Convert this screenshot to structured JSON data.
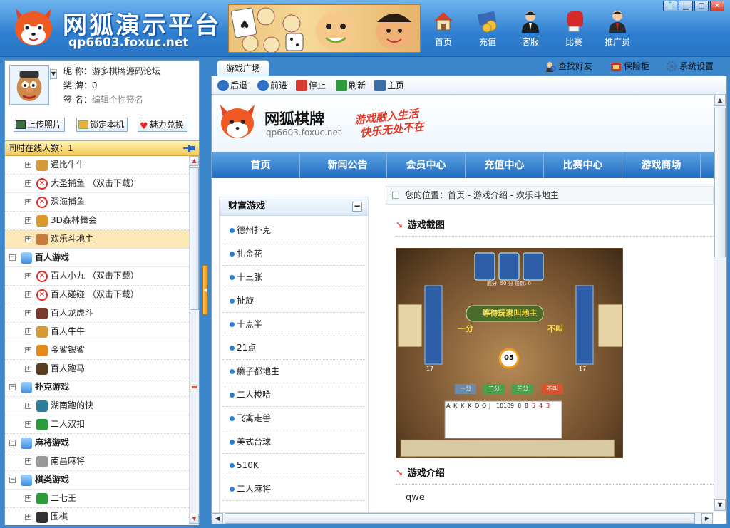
{
  "app": {
    "title": "网狐演示平台",
    "url": "qp6603.foxuc.net"
  },
  "top_nav": [
    {
      "label": "首页",
      "icon": "home-icon"
    },
    {
      "label": "充值",
      "icon": "card-icon"
    },
    {
      "label": "客服",
      "icon": "service-agent-icon"
    },
    {
      "label": "比赛",
      "icon": "boxing-glove-icon"
    },
    {
      "label": "推广员",
      "icon": "promoter-icon"
    }
  ],
  "profile": {
    "nickname_label": "昵  称：",
    "nickname": "游多棋牌源码论坛",
    "medal_label": "奖  牌：",
    "medal": "0",
    "sign_label": "签  名：",
    "sign_placeholder": "编辑个性签名",
    "buttons": [
      "上传照片",
      "锁定本机",
      "魅力兑换"
    ]
  },
  "online": {
    "label": "同时在线人数：",
    "count": "1"
  },
  "tree": [
    {
      "label": "通比牛牛",
      "type": "game",
      "icon": "cow-icon"
    },
    {
      "label": "大圣捕鱼 （双击下载）",
      "type": "game",
      "icon": "download-required-icon"
    },
    {
      "label": "深海捕鱼",
      "type": "game",
      "icon": "download-required-icon"
    },
    {
      "label": "3D森林舞会",
      "type": "game",
      "icon": "lion-icon"
    },
    {
      "label": "欢乐斗地主",
      "type": "game",
      "icon": "farmer-icon",
      "selected": true
    },
    {
      "label": "百人游戏",
      "type": "group"
    },
    {
      "label": "百人小九 （双击下载）",
      "type": "game",
      "icon": "download-required-icon"
    },
    {
      "label": "百人碰碰 （双击下载）",
      "type": "game",
      "icon": "download-required-icon"
    },
    {
      "label": "百人龙虎斗",
      "type": "game",
      "icon": "dragon-icon"
    },
    {
      "label": "百人牛牛",
      "type": "game",
      "icon": "cow-icon"
    },
    {
      "label": "金鲨银鲨",
      "type": "game",
      "icon": "shark-icon"
    },
    {
      "label": "百人跑马",
      "type": "game",
      "icon": "horse-icon"
    },
    {
      "label": "扑克游戏",
      "type": "group"
    },
    {
      "label": "湖南跑的快",
      "type": "game",
      "icon": "cards-icon"
    },
    {
      "label": "二人双扣",
      "type": "game",
      "icon": "double-icon"
    },
    {
      "label": "麻将游戏",
      "type": "group"
    },
    {
      "label": "南昌麻将",
      "type": "game",
      "icon": "mahjong-icon"
    },
    {
      "label": "棋类游戏",
      "type": "group"
    },
    {
      "label": "二七王",
      "type": "game",
      "icon": "check-icon"
    },
    {
      "label": "围棋",
      "type": "game",
      "icon": "go-board-icon"
    }
  ],
  "right_tabs": {
    "main_tab": "游戏广场",
    "tools": [
      "查找好友",
      "保险柜",
      "系统设置"
    ]
  },
  "browser_nav": [
    "后退",
    "前进",
    "停止",
    "刷新",
    "主页"
  ],
  "site": {
    "name": "网狐棋牌",
    "url": "qp6603.foxuc.net",
    "slogan1": "游戏融入生活",
    "slogan2": "快乐无处不在",
    "nav": [
      "首页",
      "新闻公告",
      "会员中心",
      "充值中心",
      "比赛中心",
      "游戏商场"
    ],
    "side_title": "财富游戏",
    "side_collapse": "−",
    "side_items": [
      "德州扑克",
      "扎金花",
      "十三张",
      "扯旋",
      "十点半",
      "21点",
      "癞子都地主",
      "二人梭哈",
      "飞禽走兽",
      "美式台球",
      "510K",
      "二人麻将"
    ],
    "breadcrumb": "您的位置：首页 - 游戏介绍 - 欢乐斗地主",
    "screenshot_title": "游戏截图",
    "intro_title": "游戏介绍",
    "intro_text": "qwe",
    "screenshot": {
      "status_text": "等待玩家叫地主",
      "left_call": "一分",
      "right_call": "不叫",
      "timer": "05",
      "buttons": [
        "一分",
        "二分",
        "三分",
        "不叫"
      ],
      "score_text": "底分: 50 分  倍数: 0",
      "left_count": "17",
      "right_count": "17",
      "hand_cards": [
        "A",
        "K",
        "K",
        "K",
        "Q",
        "Q",
        "J",
        "10",
        "10",
        "9",
        "8",
        "8",
        "5",
        "4",
        "3"
      ]
    }
  }
}
